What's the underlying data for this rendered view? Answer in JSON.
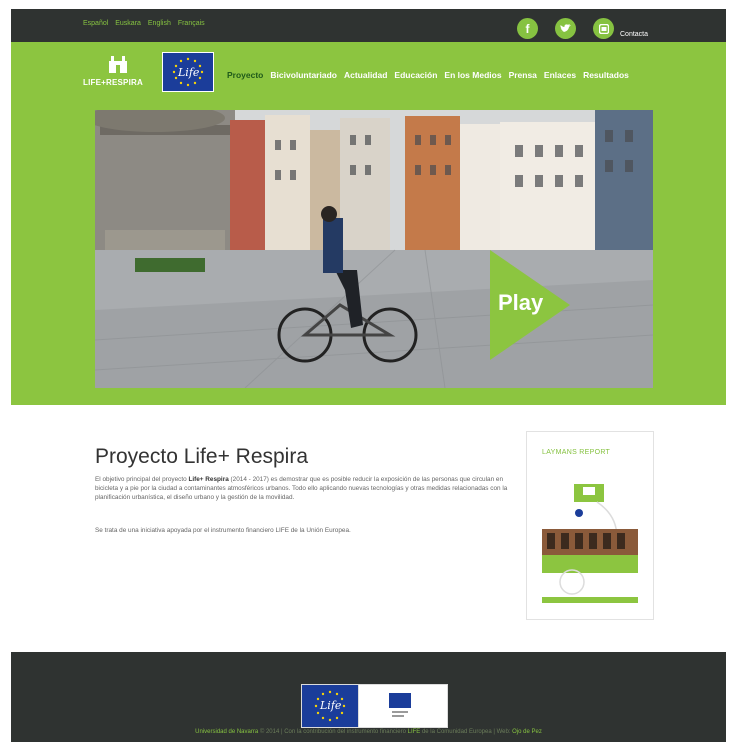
{
  "topbar": {
    "languages": [
      "Español",
      "Euskara",
      "English",
      "Français"
    ],
    "social": [
      {
        "icon": "facebook-icon",
        "glyph": "f"
      },
      {
        "icon": "twitter-icon",
        "glyph": "t"
      },
      {
        "icon": "youtube-icon",
        "glyph": "▶"
      }
    ],
    "contact_label": "Contacta"
  },
  "header": {
    "logo_text": "LIFE+RESPIRA",
    "eu_logo_text": "Life",
    "nav": [
      "Proyecto",
      "Bicivoluntariado",
      "Actualidad",
      "Educación",
      "En los Medios",
      "Prensa",
      "Enlaces",
      "Resultados"
    ],
    "active_nav": "Proyecto"
  },
  "hero": {
    "play_label": "Play"
  },
  "main": {
    "title": "Proyecto Life+ Respira",
    "paragraph1_pre": "El objetivo principal del proyecto ",
    "paragraph1_bold": "Life+ Respira",
    "paragraph1_post": " (2014 - 2017) es demostrar que es posible reducir la exposición de las personas que circulan en bicicleta y a pie por la ciudad a contaminantes atmosféricos urbanos. Todo ello aplicando nuevas tecnologías y otras medidas relacionadas con la planificación urbanística, el diseño urbano y la gestión de la movilidad.",
    "paragraph2": "Se trata de una iniciativa apoyada por el instrumento financiero LIFE de la Unión Europea.",
    "report_title": "LAYMANS REPORT"
  },
  "footer": {
    "org": "Universidad de Navarra",
    "copyright": "© 2014",
    "mid": "Con la contribución del instrumento financiero",
    "life": "LIFE",
    "tail": "de la Comunidad Europea",
    "web_label": "Web:",
    "web_author": "Ojo de Pez"
  },
  "colors": {
    "green": "#8cc540",
    "dark": "#2f3331",
    "eu_blue": "#1b3d9a"
  }
}
